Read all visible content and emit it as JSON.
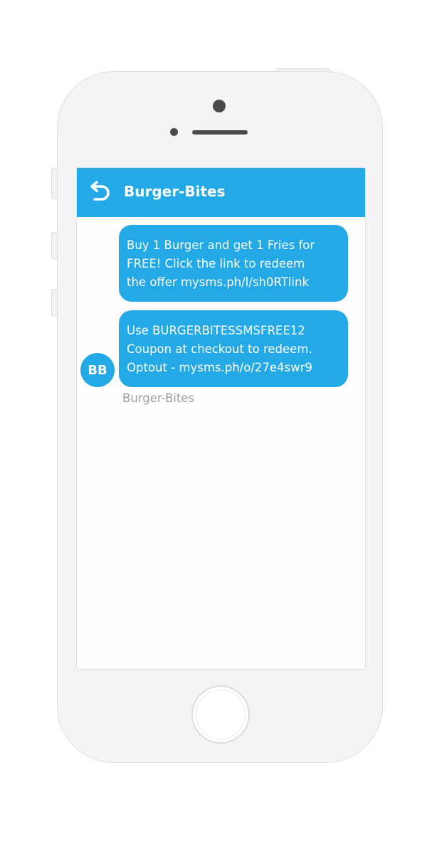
{
  "header": {
    "back_icon": "back-arrow-icon",
    "title": "Burger-Bites"
  },
  "messages": [
    {
      "lines": [
        "Buy 1 Burger and get 1 Fries for",
        "FREE! Click the link to redeem",
        "the offer mysms.ph/l/sh0RTlink"
      ]
    },
    {
      "lines": [
        "Use BURGERBITESSMSFREE12",
        "Coupon at checkout to redeem.",
        "Optout - mysms.ph/o/27e4swr9"
      ]
    }
  ],
  "sender": {
    "avatar_initials": "BB",
    "name": "Burger-Bites"
  },
  "colors": {
    "accent": "#22a9e6",
    "sender_name": "#9e9e9e",
    "phone_body": "#f4f4f4"
  }
}
